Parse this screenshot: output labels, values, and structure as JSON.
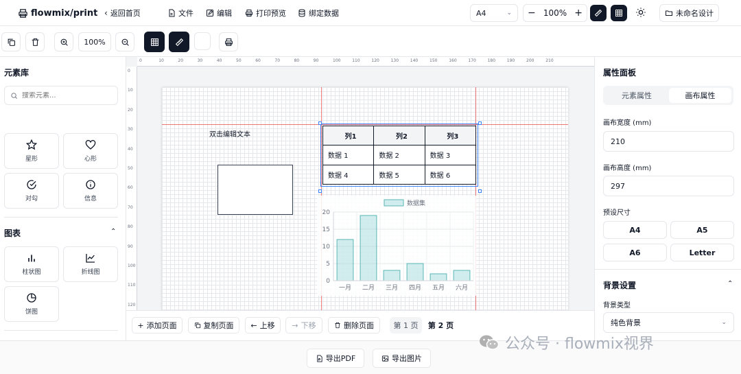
{
  "topbar": {
    "brand": "flowmix/print",
    "back": "返回首页",
    "menu_file": "文件",
    "menu_edit": "编辑",
    "menu_preview": "打印预览",
    "menu_bind": "绑定数据",
    "paper": "A4",
    "zoom": "100%",
    "design_name": "未命名设计"
  },
  "toolbar": {
    "zoom": "100%"
  },
  "left": {
    "title": "元素库",
    "search_placeholder": "搜索元素...",
    "shapes": [
      {
        "label": "星形",
        "icon": "star-icon"
      },
      {
        "label": "心形",
        "icon": "heart-icon"
      },
      {
        "label": "对勾",
        "icon": "check-circle-icon"
      },
      {
        "label": "信息",
        "icon": "info-icon"
      }
    ],
    "chart_section": "图表",
    "charts": [
      {
        "label": "柱状图",
        "icon": "bar-chart-icon"
      },
      {
        "label": "折线图",
        "icon": "line-chart-icon"
      },
      {
        "label": "饼图",
        "icon": "pie-chart-icon"
      }
    ]
  },
  "canvas": {
    "text_element": "双击编辑文本",
    "table": {
      "headers": [
        "列1",
        "列2",
        "列3"
      ],
      "rows": [
        [
          "数据 1",
          "数据 2",
          "数据 3"
        ],
        [
          "数据 4",
          "数据 5",
          "数据 6"
        ]
      ]
    },
    "ruler_top": [
      "0",
      "10",
      "20",
      "30",
      "40",
      "50",
      "60",
      "70",
      "80",
      "90",
      "100",
      "110",
      "120",
      "130",
      "140",
      "150",
      "160",
      "170",
      "180",
      "190",
      "200",
      "210"
    ],
    "ruler_left": [
      "0",
      "10",
      "20",
      "30",
      "40",
      "50",
      "60",
      "70",
      "80",
      "90",
      "100",
      "110",
      "120"
    ]
  },
  "chart_data": {
    "type": "bar",
    "categories": [
      "一月",
      "二月",
      "三月",
      "四月",
      "五月",
      "六月"
    ],
    "series": [
      {
        "name": "数据集",
        "values": [
          12,
          19,
          3,
          5,
          2,
          3
        ]
      }
    ],
    "ylim": [
      0,
      20
    ],
    "yticks": [
      0,
      5,
      10,
      15,
      20
    ],
    "color": "#99d6d6"
  },
  "canvas_footer": {
    "add_page": "添加页面",
    "copy_page": "复制页面",
    "move_up": "上移",
    "move_down": "下移",
    "delete_page": "删除页面",
    "page1": "第 1 页",
    "page2": "第 2 页"
  },
  "right": {
    "title": "属性面板",
    "tab_element": "元素属性",
    "tab_canvas": "画布属性",
    "width_label": "画布宽度 (mm)",
    "width_value": "210",
    "height_label": "画布高度 (mm)",
    "height_value": "297",
    "preset_label": "预设尺寸",
    "presets": [
      "A4",
      "A5",
      "A6",
      "Letter"
    ],
    "bg_section": "背景设置",
    "bg_type_label": "背景类型",
    "bg_type_value": "纯色背景"
  },
  "bottom": {
    "export_pdf": "导出PDF",
    "export_image": "导出图片",
    "watermark": "公众号 · flowmix视界"
  }
}
